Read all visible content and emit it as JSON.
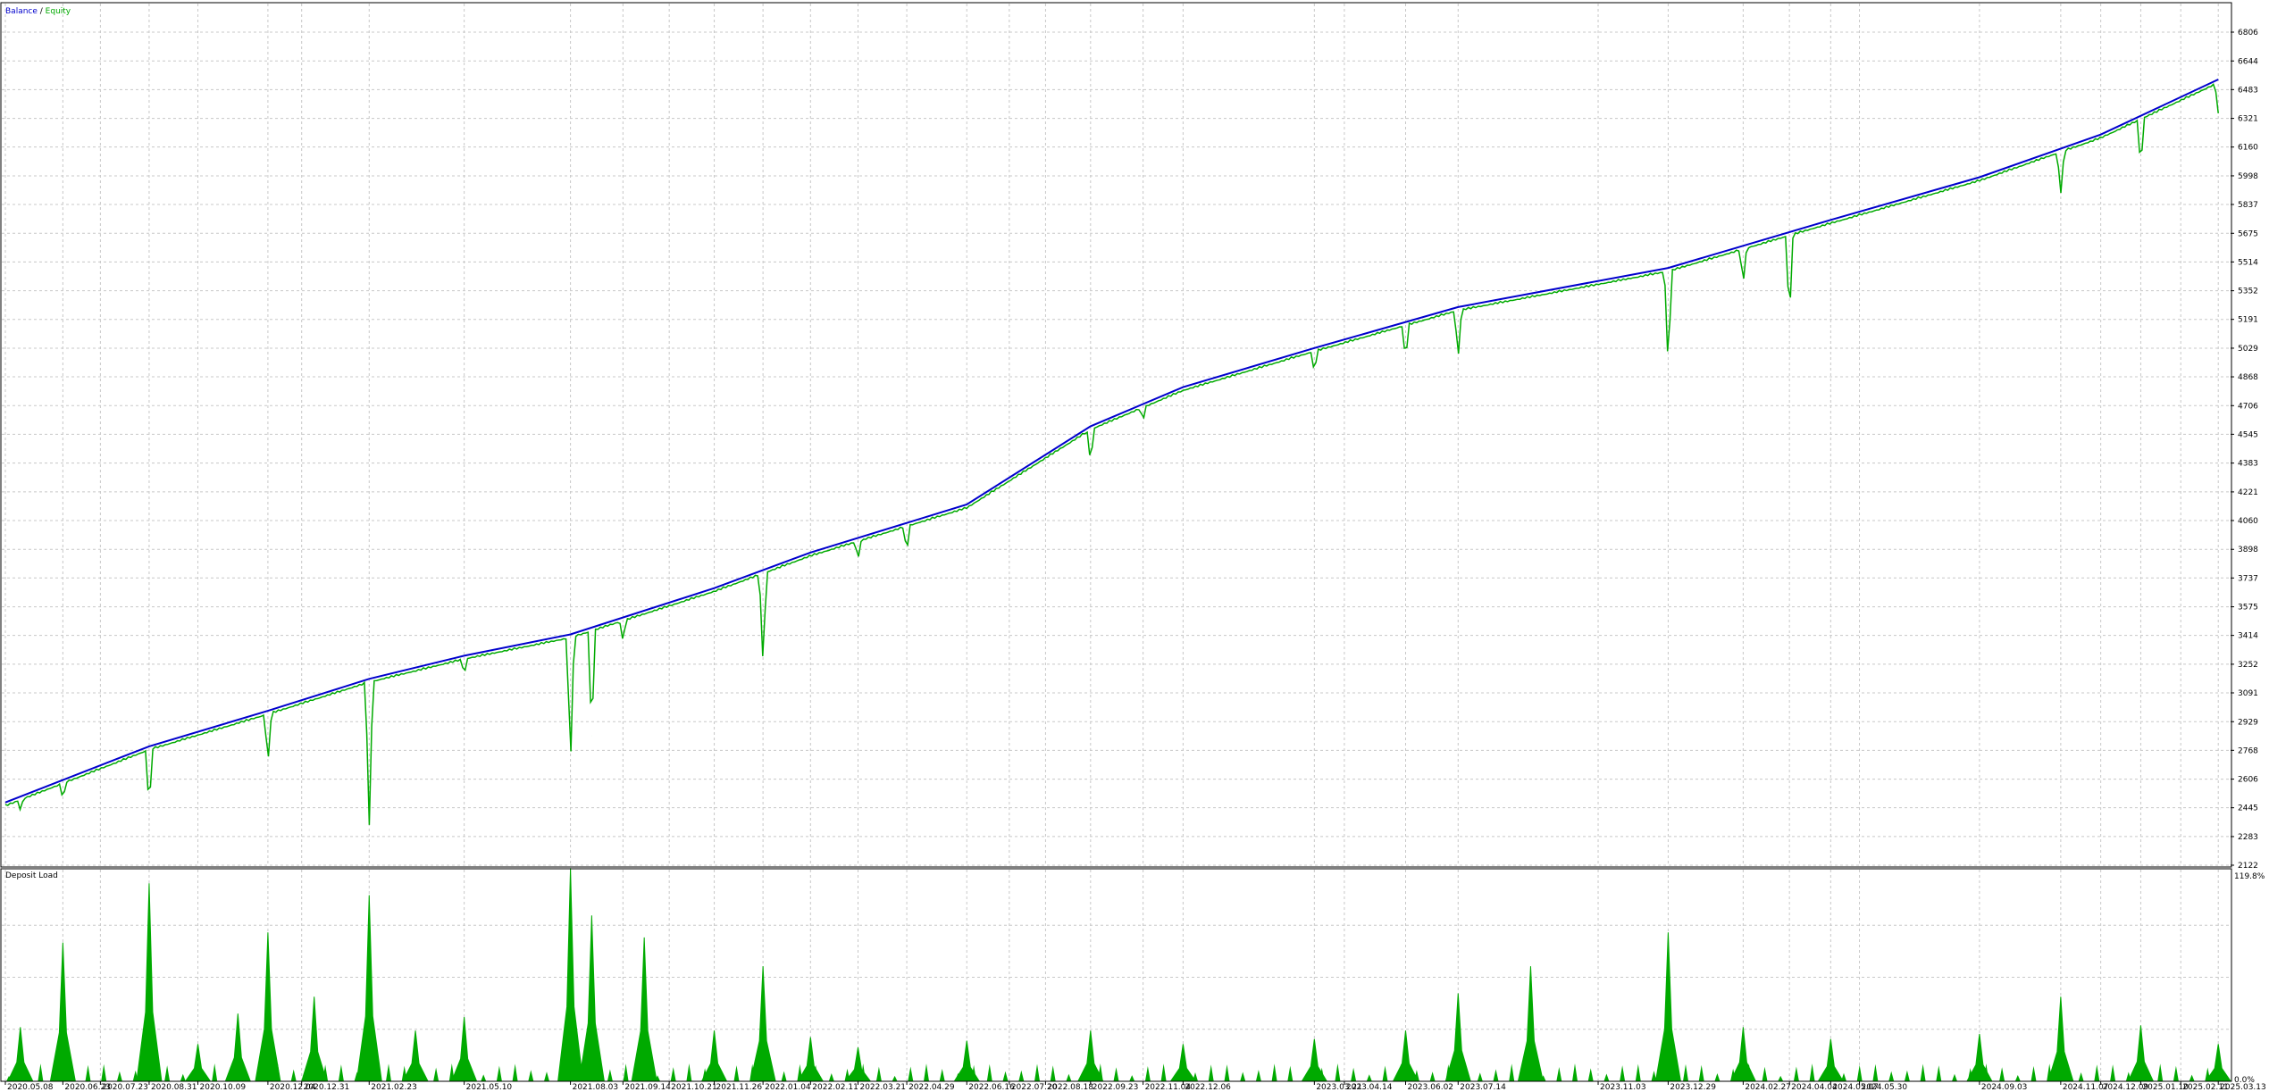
{
  "legend": {
    "balance": "Balance",
    "separator": " / ",
    "equity": "Equity"
  },
  "panels": {
    "deposit_load_label": "Deposit Load"
  },
  "colors": {
    "balance": "#0000cc",
    "equity": "#00aa00",
    "grid": "#c8c8c8",
    "frame": "#000000"
  },
  "chart_data": [
    {
      "type": "line",
      "title": "",
      "series": [
        {
          "name": "Balance",
          "color": "#0000cc",
          "x": [
            "2020.05.08",
            "2020.08.31",
            "2020.12.04",
            "2021.02.23",
            "2021.05.10",
            "2021.08.03",
            "2021.11.26",
            "2022.02.11",
            "2022.06.16",
            "2022.09.23",
            "2022.12.06",
            "2023.03.21",
            "2023.07.14",
            "2023.12.29",
            "2024.05.07",
            "2024.09.03",
            "2024.12.09",
            "2025.03.13"
          ],
          "values": [
            2475,
            2790,
            2990,
            3170,
            3300,
            3420,
            3680,
            3880,
            4150,
            4590,
            4810,
            5030,
            5260,
            5480,
            5750,
            5990,
            6230,
            6540
          ]
        },
        {
          "name": "Equity",
          "color": "#00aa00",
          "drawdowns": [
            {
              "x": "2020.05.20",
              "low": 2430
            },
            {
              "x": "2020.06.23",
              "low": 2490
            },
            {
              "x": "2020.08.31",
              "low": 2440
            },
            {
              "x": "2020.12.04",
              "low": 2690
            },
            {
              "x": "2021.02.23",
              "low": 2330
            },
            {
              "x": "2021.05.10",
              "low": 3190
            },
            {
              "x": "2021.08.03",
              "low": 2680
            },
            {
              "x": "2021.08.20",
              "low": 2850
            },
            {
              "x": "2021.09.14",
              "low": 3380
            },
            {
              "x": "2022.01.04",
              "low": 3250
            },
            {
              "x": "2022.03.21",
              "low": 3840
            },
            {
              "x": "2022.04.29",
              "low": 3880
            },
            {
              "x": "2022.09.23",
              "low": 4380
            },
            {
              "x": "2022.11.04",
              "low": 4620
            },
            {
              "x": "2023.03.21",
              "low": 4890
            },
            {
              "x": "2023.06.02",
              "low": 4960
            },
            {
              "x": "2023.07.14",
              "low": 4970
            },
            {
              "x": "2023.12.29",
              "low": 4910
            },
            {
              "x": "2024.02.27",
              "low": 5390
            },
            {
              "x": "2024.04.04",
              "low": 5180
            },
            {
              "x": "2024.11.07",
              "low": 5890
            },
            {
              "x": "2025.01.10",
              "low": 6040
            },
            {
              "x": "2025.03.13",
              "low": 6350
            }
          ]
        }
      ],
      "x_tick_labels": [
        "2020.05.08",
        "2020.06.23",
        "2020.07.23",
        "2020.08.31",
        "2020.10.09",
        "2020.12.04",
        "2020.12.31",
        "2021.02.23",
        "2021.05.10",
        "2021.08.03",
        "2021.09.14",
        "2021.10.21",
        "2021.11.26",
        "2022.01.04",
        "2022.02.11",
        "2022.03.21",
        "2022.04.29",
        "2022.06.16",
        "2022.07.20",
        "2022.08.18",
        "2022.09.23",
        "2022.11.04",
        "2022.12.06",
        "2023.03.21",
        "2023.04.14",
        "2023.06.02",
        "2023.07.14",
        "2023.11.03",
        "2023.12.29",
        "2024.02.27",
        "2024.04.04",
        "2024.05.07",
        "2024.05.30",
        "2024.09.03",
        "2024.11.07",
        "2024.12.09",
        "2025.01.10",
        "2025.02.11",
        "2025.03.13"
      ],
      "y_tick_labels": [
        "6806",
        "6644",
        "6483",
        "6321",
        "6160",
        "5998",
        "5837",
        "5675",
        "5514",
        "5352",
        "5191",
        "5029",
        "4868",
        "4706",
        "4545",
        "4383",
        "4221",
        "4060",
        "3898",
        "3737",
        "3575",
        "3414",
        "3252",
        "3091",
        "2929",
        "2768",
        "2606",
        "2445",
        "2283",
        "2122"
      ],
      "ylim": [
        2122,
        6806
      ],
      "grid": true,
      "legend_position": "top-left"
    },
    {
      "type": "area",
      "title": "Deposit Load",
      "y_tick_labels": [
        "119.8%",
        "0.0%"
      ],
      "ylim": [
        0,
        119.8
      ],
      "peaks": [
        {
          "x": "2020.05.20",
          "v": 32
        },
        {
          "x": "2020.06.23",
          "v": 82
        },
        {
          "x": "2020.08.31",
          "v": 117
        },
        {
          "x": "2020.10.09",
          "v": 22
        },
        {
          "x": "2020.11.10",
          "v": 40
        },
        {
          "x": "2020.12.04",
          "v": 88
        },
        {
          "x": "2021.01.10",
          "v": 50
        },
        {
          "x": "2021.02.23",
          "v": 110
        },
        {
          "x": "2021.04.01",
          "v": 30
        },
        {
          "x": "2021.05.10",
          "v": 38
        },
        {
          "x": "2021.08.03",
          "v": 126
        },
        {
          "x": "2021.08.20",
          "v": 98
        },
        {
          "x": "2021.10.01",
          "v": 85
        },
        {
          "x": "2021.11.26",
          "v": 30
        },
        {
          "x": "2022.01.04",
          "v": 68
        },
        {
          "x": "2022.02.11",
          "v": 26
        },
        {
          "x": "2022.03.21",
          "v": 20
        },
        {
          "x": "2022.06.16",
          "v": 24
        },
        {
          "x": "2022.09.23",
          "v": 30
        },
        {
          "x": "2022.12.06",
          "v": 22
        },
        {
          "x": "2023.03.21",
          "v": 25
        },
        {
          "x": "2023.06.02",
          "v": 30
        },
        {
          "x": "2023.07.14",
          "v": 52
        },
        {
          "x": "2023.09.10",
          "v": 68
        },
        {
          "x": "2023.12.29",
          "v": 88
        },
        {
          "x": "2024.02.27",
          "v": 32
        },
        {
          "x": "2024.05.07",
          "v": 25
        },
        {
          "x": "2024.09.03",
          "v": 28
        },
        {
          "x": "2024.11.07",
          "v": 50
        },
        {
          "x": "2025.01.10",
          "v": 33
        },
        {
          "x": "2025.03.13",
          "v": 22
        }
      ]
    }
  ]
}
